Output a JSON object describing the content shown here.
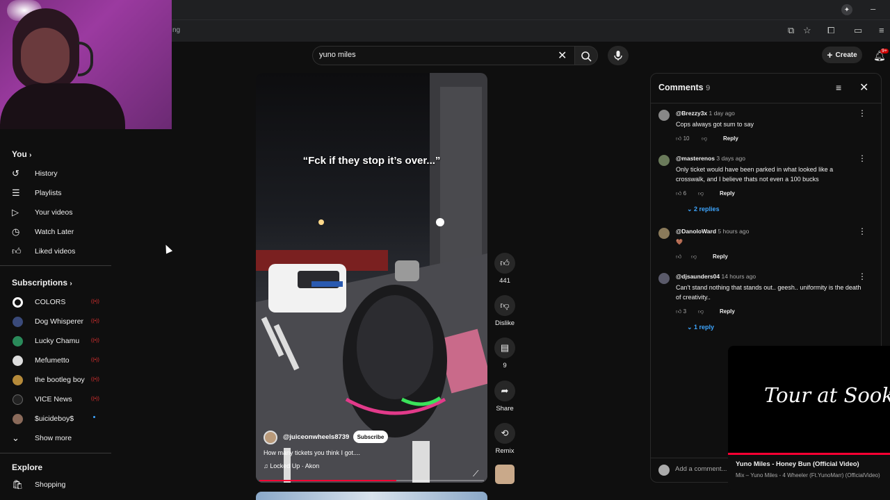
{
  "browser": {
    "url_fragment": "ng",
    "icons": [
      "extension-icon",
      "star-icon",
      "puzzle-icon",
      "split-icon",
      "menu-icon"
    ],
    "minimize": "–"
  },
  "header": {
    "search_value": "yuno miles",
    "create_label": "Create",
    "notification_badge": "9+"
  },
  "sidebar": {
    "you_label": "You",
    "you_items": [
      {
        "label": "History",
        "icon": "history-icon"
      },
      {
        "label": "Playlists",
        "icon": "playlists-icon"
      },
      {
        "label": "Your videos",
        "icon": "your-videos-icon"
      },
      {
        "label": "Watch Later",
        "icon": "watch-later-icon"
      },
      {
        "label": "Liked videos",
        "icon": "liked-videos-icon"
      }
    ],
    "subscriptions_label": "Subscriptions",
    "subscriptions": [
      {
        "label": "COLORS",
        "color": "#111111",
        "live": true
      },
      {
        "label": "Dog Whisperer",
        "color": "#3a4a7a",
        "live": true
      },
      {
        "label": "Lucky Chamu",
        "color": "#2a8a5a",
        "live": true
      },
      {
        "label": "Mefumetto",
        "color": "#dddddd",
        "live": true
      },
      {
        "label": "the bootleg boy",
        "color": "#b58a3a",
        "live": true
      },
      {
        "label": "VICE News",
        "color": "#222222",
        "live": true
      },
      {
        "label": "$uicideboy$",
        "color": "#8a6a5a",
        "live": false
      }
    ],
    "show_more_label": "Show more",
    "explore_label": "Explore",
    "shopping_label": "Shopping"
  },
  "short": {
    "caption": "“Fck if they stop it’s over...”",
    "channel": "@juiceonwheels8739",
    "subscribe_label": "Subscribe",
    "title": "How many tickets you think I got....",
    "sound": "Locked Up · Akon",
    "progress": 0.61,
    "actions": {
      "like_count": "441",
      "dislike_label": "Dislike",
      "comment_count": "9",
      "share_label": "Share",
      "remix_label": "Remix"
    }
  },
  "comments": {
    "title": "Comments",
    "count": "9",
    "add_placeholder": "Add a comment...",
    "items": [
      {
        "user": "@Brezzy3x",
        "time": "1 day ago",
        "text": "Cops always got sum to say",
        "likes": "10",
        "reply_label": "Reply",
        "replies": "",
        "avatar": "#888888"
      },
      {
        "user": "@masterenos",
        "time": "3 days ago",
        "text": "Only ticket would have been parked in what looked like a crosswalk, and I believe thats not even a 100 bucks",
        "likes": "6",
        "reply_label": "Reply",
        "replies": "2 replies",
        "avatar": "#6a7a5a"
      },
      {
        "user": "@DanoloWard",
        "time": "5 hours ago",
        "text": "🤎",
        "likes": "",
        "reply_label": "Reply",
        "replies": "",
        "avatar": "#8a7a5a"
      },
      {
        "user": "@djsaunders04",
        "time": "14 hours ago",
        "text": "Can't stand nothing that stands out.. geesh.. uniformity is the death of creativity..",
        "likes": "3",
        "reply_label": "Reply",
        "replies": "1 reply",
        "avatar": "#5a5a6a"
      }
    ]
  },
  "miniplayer": {
    "caption": "Tour at Sook",
    "title": "Yuno Miles - Honey Bun (Official Video)",
    "subtitle": "Mix – Yuno Miles - 4 Wheeler (Ft.YunoMarr) (OfficialVideo)"
  }
}
